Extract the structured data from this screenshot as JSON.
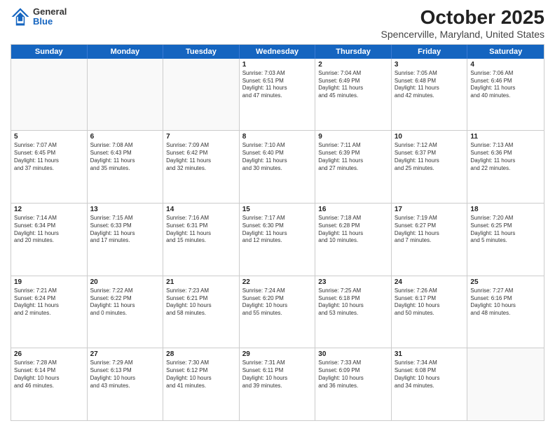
{
  "header": {
    "logo": {
      "general": "General",
      "blue": "Blue"
    },
    "title": "October 2025",
    "subtitle": "Spencerville, Maryland, United States"
  },
  "calendar": {
    "weekdays": [
      "Sunday",
      "Monday",
      "Tuesday",
      "Wednesday",
      "Thursday",
      "Friday",
      "Saturday"
    ],
    "weeks": [
      [
        {
          "day": "",
          "empty": true
        },
        {
          "day": "",
          "empty": true
        },
        {
          "day": "",
          "empty": true
        },
        {
          "day": "1",
          "lines": [
            "Sunrise: 7:03 AM",
            "Sunset: 6:51 PM",
            "Daylight: 11 hours",
            "and 47 minutes."
          ]
        },
        {
          "day": "2",
          "lines": [
            "Sunrise: 7:04 AM",
            "Sunset: 6:49 PM",
            "Daylight: 11 hours",
            "and 45 minutes."
          ]
        },
        {
          "day": "3",
          "lines": [
            "Sunrise: 7:05 AM",
            "Sunset: 6:48 PM",
            "Daylight: 11 hours",
            "and 42 minutes."
          ]
        },
        {
          "day": "4",
          "lines": [
            "Sunrise: 7:06 AM",
            "Sunset: 6:46 PM",
            "Daylight: 11 hours",
            "and 40 minutes."
          ]
        }
      ],
      [
        {
          "day": "5",
          "lines": [
            "Sunrise: 7:07 AM",
            "Sunset: 6:45 PM",
            "Daylight: 11 hours",
            "and 37 minutes."
          ]
        },
        {
          "day": "6",
          "lines": [
            "Sunrise: 7:08 AM",
            "Sunset: 6:43 PM",
            "Daylight: 11 hours",
            "and 35 minutes."
          ]
        },
        {
          "day": "7",
          "lines": [
            "Sunrise: 7:09 AM",
            "Sunset: 6:42 PM",
            "Daylight: 11 hours",
            "and 32 minutes."
          ]
        },
        {
          "day": "8",
          "lines": [
            "Sunrise: 7:10 AM",
            "Sunset: 6:40 PM",
            "Daylight: 11 hours",
            "and 30 minutes."
          ]
        },
        {
          "day": "9",
          "lines": [
            "Sunrise: 7:11 AM",
            "Sunset: 6:39 PM",
            "Daylight: 11 hours",
            "and 27 minutes."
          ]
        },
        {
          "day": "10",
          "lines": [
            "Sunrise: 7:12 AM",
            "Sunset: 6:37 PM",
            "Daylight: 11 hours",
            "and 25 minutes."
          ]
        },
        {
          "day": "11",
          "lines": [
            "Sunrise: 7:13 AM",
            "Sunset: 6:36 PM",
            "Daylight: 11 hours",
            "and 22 minutes."
          ]
        }
      ],
      [
        {
          "day": "12",
          "lines": [
            "Sunrise: 7:14 AM",
            "Sunset: 6:34 PM",
            "Daylight: 11 hours",
            "and 20 minutes."
          ]
        },
        {
          "day": "13",
          "lines": [
            "Sunrise: 7:15 AM",
            "Sunset: 6:33 PM",
            "Daylight: 11 hours",
            "and 17 minutes."
          ]
        },
        {
          "day": "14",
          "lines": [
            "Sunrise: 7:16 AM",
            "Sunset: 6:31 PM",
            "Daylight: 11 hours",
            "and 15 minutes."
          ]
        },
        {
          "day": "15",
          "lines": [
            "Sunrise: 7:17 AM",
            "Sunset: 6:30 PM",
            "Daylight: 11 hours",
            "and 12 minutes."
          ]
        },
        {
          "day": "16",
          "lines": [
            "Sunrise: 7:18 AM",
            "Sunset: 6:28 PM",
            "Daylight: 11 hours",
            "and 10 minutes."
          ]
        },
        {
          "day": "17",
          "lines": [
            "Sunrise: 7:19 AM",
            "Sunset: 6:27 PM",
            "Daylight: 11 hours",
            "and 7 minutes."
          ]
        },
        {
          "day": "18",
          "lines": [
            "Sunrise: 7:20 AM",
            "Sunset: 6:25 PM",
            "Daylight: 11 hours",
            "and 5 minutes."
          ]
        }
      ],
      [
        {
          "day": "19",
          "lines": [
            "Sunrise: 7:21 AM",
            "Sunset: 6:24 PM",
            "Daylight: 11 hours",
            "and 2 minutes."
          ]
        },
        {
          "day": "20",
          "lines": [
            "Sunrise: 7:22 AM",
            "Sunset: 6:22 PM",
            "Daylight: 11 hours",
            "and 0 minutes."
          ]
        },
        {
          "day": "21",
          "lines": [
            "Sunrise: 7:23 AM",
            "Sunset: 6:21 PM",
            "Daylight: 10 hours",
            "and 58 minutes."
          ]
        },
        {
          "day": "22",
          "lines": [
            "Sunrise: 7:24 AM",
            "Sunset: 6:20 PM",
            "Daylight: 10 hours",
            "and 55 minutes."
          ]
        },
        {
          "day": "23",
          "lines": [
            "Sunrise: 7:25 AM",
            "Sunset: 6:18 PM",
            "Daylight: 10 hours",
            "and 53 minutes."
          ]
        },
        {
          "day": "24",
          "lines": [
            "Sunrise: 7:26 AM",
            "Sunset: 6:17 PM",
            "Daylight: 10 hours",
            "and 50 minutes."
          ]
        },
        {
          "day": "25",
          "lines": [
            "Sunrise: 7:27 AM",
            "Sunset: 6:16 PM",
            "Daylight: 10 hours",
            "and 48 minutes."
          ]
        }
      ],
      [
        {
          "day": "26",
          "lines": [
            "Sunrise: 7:28 AM",
            "Sunset: 6:14 PM",
            "Daylight: 10 hours",
            "and 46 minutes."
          ]
        },
        {
          "day": "27",
          "lines": [
            "Sunrise: 7:29 AM",
            "Sunset: 6:13 PM",
            "Daylight: 10 hours",
            "and 43 minutes."
          ]
        },
        {
          "day": "28",
          "lines": [
            "Sunrise: 7:30 AM",
            "Sunset: 6:12 PM",
            "Daylight: 10 hours",
            "and 41 minutes."
          ]
        },
        {
          "day": "29",
          "lines": [
            "Sunrise: 7:31 AM",
            "Sunset: 6:11 PM",
            "Daylight: 10 hours",
            "and 39 minutes."
          ]
        },
        {
          "day": "30",
          "lines": [
            "Sunrise: 7:33 AM",
            "Sunset: 6:09 PM",
            "Daylight: 10 hours",
            "and 36 minutes."
          ]
        },
        {
          "day": "31",
          "lines": [
            "Sunrise: 7:34 AM",
            "Sunset: 6:08 PM",
            "Daylight: 10 hours",
            "and 34 minutes."
          ]
        },
        {
          "day": "",
          "empty": true
        }
      ]
    ]
  }
}
